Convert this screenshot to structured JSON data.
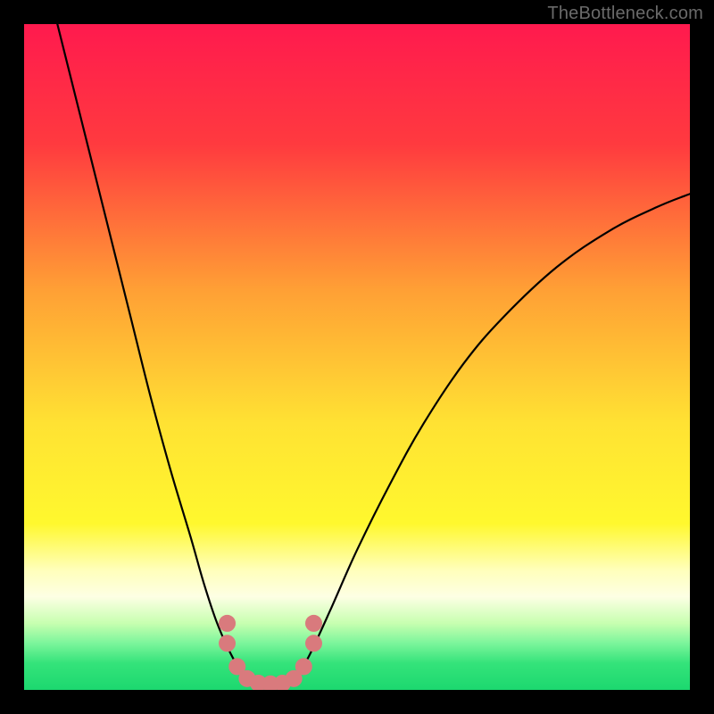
{
  "watermark": "TheBottleneck.com",
  "chart_data": {
    "type": "line",
    "title": "",
    "xlabel": "",
    "ylabel": "",
    "xlim": [
      0,
      100
    ],
    "ylim": [
      0,
      100
    ],
    "background_gradient": {
      "stops": [
        {
          "offset": 0.0,
          "color": "#ff1a4e"
        },
        {
          "offset": 0.18,
          "color": "#ff3a3f"
        },
        {
          "offset": 0.4,
          "color": "#ffa035"
        },
        {
          "offset": 0.6,
          "color": "#ffe233"
        },
        {
          "offset": 0.75,
          "color": "#fff82e"
        },
        {
          "offset": 0.82,
          "color": "#ffffbb"
        },
        {
          "offset": 0.86,
          "color": "#fdffe4"
        },
        {
          "offset": 0.9,
          "color": "#c7ffb0"
        },
        {
          "offset": 0.93,
          "color": "#7bf59b"
        },
        {
          "offset": 0.96,
          "color": "#34e37a"
        },
        {
          "offset": 1.0,
          "color": "#1cd86f"
        }
      ]
    },
    "series": [
      {
        "name": "curve-left",
        "stroke": "#000000",
        "stroke_width": 2.2,
        "points": [
          {
            "x": 5.0,
            "y": 100.0
          },
          {
            "x": 7.0,
            "y": 92.0
          },
          {
            "x": 10.0,
            "y": 80.0
          },
          {
            "x": 13.0,
            "y": 68.0
          },
          {
            "x": 16.0,
            "y": 56.0
          },
          {
            "x": 19.0,
            "y": 44.0
          },
          {
            "x": 22.0,
            "y": 33.0
          },
          {
            "x": 25.0,
            "y": 23.0
          },
          {
            "x": 27.0,
            "y": 16.0
          },
          {
            "x": 29.0,
            "y": 10.0
          },
          {
            "x": 31.0,
            "y": 5.5
          },
          {
            "x": 32.5,
            "y": 3.0
          },
          {
            "x": 34.0,
            "y": 1.5
          },
          {
            "x": 35.5,
            "y": 0.8
          },
          {
            "x": 37.0,
            "y": 0.6
          }
        ]
      },
      {
        "name": "curve-right",
        "stroke": "#000000",
        "stroke_width": 2.2,
        "points": [
          {
            "x": 37.0,
            "y": 0.6
          },
          {
            "x": 38.5,
            "y": 0.8
          },
          {
            "x": 40.0,
            "y": 1.5
          },
          {
            "x": 41.5,
            "y": 3.0
          },
          {
            "x": 43.0,
            "y": 5.5
          },
          {
            "x": 46.0,
            "y": 12.0
          },
          {
            "x": 50.0,
            "y": 21.0
          },
          {
            "x": 55.0,
            "y": 31.0
          },
          {
            "x": 60.0,
            "y": 40.0
          },
          {
            "x": 66.0,
            "y": 49.0
          },
          {
            "x": 72.0,
            "y": 56.0
          },
          {
            "x": 80.0,
            "y": 63.5
          },
          {
            "x": 88.0,
            "y": 69.0
          },
          {
            "x": 95.0,
            "y": 72.5
          },
          {
            "x": 100.0,
            "y": 74.5
          }
        ]
      },
      {
        "name": "markers",
        "type": "scatter",
        "fill": "#d97a7d",
        "stroke": "#d97a7d",
        "radius": 9,
        "points": [
          {
            "x": 30.5,
            "y": 10.0
          },
          {
            "x": 30.5,
            "y": 7.0
          },
          {
            "x": 32.0,
            "y": 3.5
          },
          {
            "x": 33.5,
            "y": 1.7
          },
          {
            "x": 35.2,
            "y": 1.0
          },
          {
            "x": 37.0,
            "y": 0.9
          },
          {
            "x": 38.8,
            "y": 1.0
          },
          {
            "x": 40.5,
            "y": 1.7
          },
          {
            "x": 42.0,
            "y": 3.5
          },
          {
            "x": 43.5,
            "y": 7.0
          },
          {
            "x": 43.5,
            "y": 10.0
          }
        ]
      }
    ]
  }
}
